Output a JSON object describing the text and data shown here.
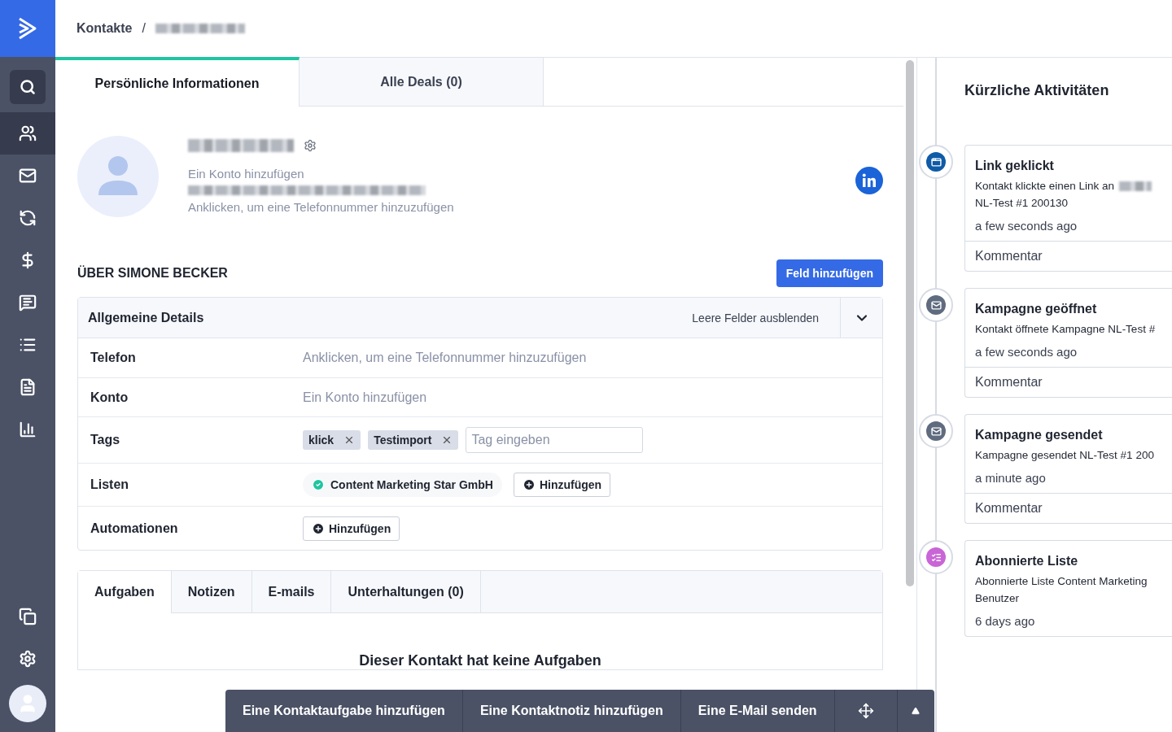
{
  "sidebar": {
    "items": [
      {
        "kind": "search",
        "selected": false
      },
      {
        "kind": "contacts",
        "selected": true
      },
      {
        "kind": "mail",
        "selected": false
      },
      {
        "kind": "automation",
        "selected": false
      },
      {
        "kind": "deals",
        "selected": false
      },
      {
        "kind": "conversations",
        "selected": false
      },
      {
        "kind": "lists",
        "selected": false
      },
      {
        "kind": "forms",
        "selected": false
      },
      {
        "kind": "reports",
        "selected": false
      }
    ],
    "bottom_items": [
      {
        "kind": "pages",
        "selected": false
      },
      {
        "kind": "settings",
        "selected": false
      },
      {
        "kind": "avatar",
        "selected": false
      }
    ]
  },
  "breadcrumb": {
    "root": "Kontakte",
    "separator": "/",
    "current_redacted": true
  },
  "tabs": [
    {
      "label": "Persönliche Informationen",
      "selected": true
    },
    {
      "label": "Alle Deals (0)",
      "selected": false
    }
  ],
  "profile": {
    "name_redacted": true,
    "account_placeholder": "Ein Konto hinzufügen",
    "email_redacted": true,
    "phone_placeholder": "Anklicken, um eine Telefonnummer hinzuzufügen"
  },
  "about": {
    "title": "ÜBER SIMONE BECKER",
    "add_field_button": "Feld hinzufügen",
    "section": {
      "title": "Allgemeine Details",
      "hide_empty": "Leere Felder ausblenden",
      "expanded": true
    },
    "fields": [
      {
        "kind": "placeholder",
        "label": "Telefon",
        "placeholder": "Anklicken, um eine Telefonnummer hinzuzufügen"
      },
      {
        "kind": "placeholder",
        "label": "Konto",
        "placeholder": "Ein Konto hinzufügen"
      },
      {
        "kind": "tags",
        "label": "Tags",
        "tags": [
          "klick",
          "Testimport"
        ],
        "placeholder": "Tag eingeben"
      },
      {
        "kind": "lists",
        "label": "Listen",
        "lists": [
          "Content Marketing Star GmbH"
        ],
        "button": "Hinzufügen"
      },
      {
        "kind": "button",
        "label": "Automationen",
        "button": "Hinzufügen"
      }
    ]
  },
  "lower_tabs": [
    {
      "label": "Aufgaben",
      "selected": true
    },
    {
      "label": "Notizen",
      "selected": false
    },
    {
      "label": "E-mails",
      "selected": false
    },
    {
      "label": "Unterhaltungen (0)",
      "selected": false
    }
  ],
  "empty_state": {
    "title": "Dieser Kontakt hat keine Aufgaben"
  },
  "activity": {
    "title": "Kürzliche Aktivitäten",
    "items": [
      {
        "kind": "link",
        "color": "#0f5ba7",
        "title": "Link geklickt",
        "lines": [
          "Kontakt klickte einen Link an",
          "NL-Test #1 200130"
        ],
        "redacted": true,
        "time": "a few seconds ago",
        "comment": "Kommentar"
      },
      {
        "kind": "email",
        "color": "#5f6b7f",
        "title": "Kampagne geöffnet",
        "lines": [
          "Kontakt öffnete Kampagne NL-Test #"
        ],
        "time": "a few seconds ago",
        "comment": "Kommentar"
      },
      {
        "kind": "email",
        "color": "#5f6b7f",
        "title": "Kampagne gesendet",
        "lines": [
          "Kampagne gesendet NL-Test #1 200"
        ],
        "time": "a minute ago",
        "comment": "Kommentar"
      },
      {
        "kind": "list",
        "color": "#c965d6",
        "title": "Abonnierte Liste",
        "lines": [
          "Abonnierte Liste Content Marketing",
          "Benutzer"
        ],
        "time": "6 days ago"
      }
    ]
  },
  "action_bar": {
    "buttons": [
      "Eine Kontaktaufgabe hinzufügen",
      "Eine Kontaktnotiz hinzufügen",
      "Eine E-Mail senden"
    ]
  }
}
